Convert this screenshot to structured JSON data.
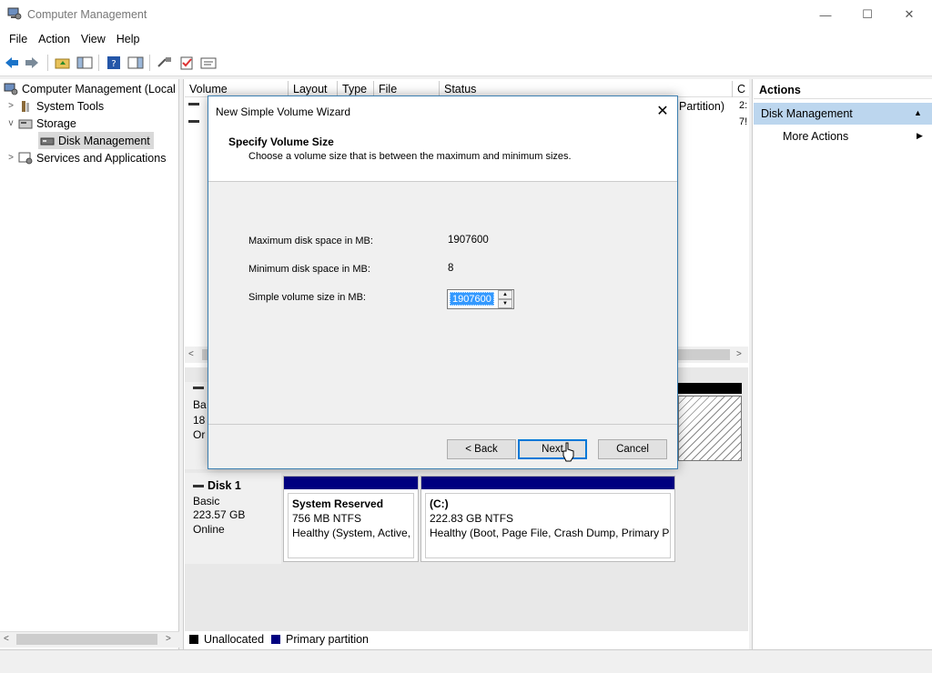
{
  "window": {
    "title": "Computer Management",
    "controls": [
      "—",
      "☐",
      "✕"
    ]
  },
  "menu": [
    "File",
    "Action",
    "View",
    "Help"
  ],
  "tree": {
    "root": "Computer Management (Local",
    "system_tools": "System Tools",
    "storage": "Storage",
    "disk_management": "Disk Management",
    "services": "Services and Applications"
  },
  "volume_columns": [
    "Volume",
    "Layout",
    "Type",
    "File System",
    "Status",
    "C"
  ],
  "partial_text": {
    "partition": "Partition)",
    "cap1": "2:",
    "cap2": "7!",
    "disk0_line1": "Ba",
    "disk0_line2": "18",
    "disk0_line3": "Or"
  },
  "disk1": {
    "name": "Disk 1",
    "type": "Basic",
    "size": "223.57 GB",
    "status": "Online",
    "partitions": [
      {
        "name": "System Reserved",
        "size": "756 MB NTFS",
        "health": "Healthy (System, Active,"
      },
      {
        "name": "(C:)",
        "size": "222.83 GB NTFS",
        "health": "Healthy (Boot, Page File, Crash Dump, Primary P"
      }
    ]
  },
  "legend": {
    "unallocated": "Unallocated",
    "primary": "Primary partition",
    "unallocated_color": "#000000",
    "primary_color": "#000080"
  },
  "actions": {
    "title": "Actions",
    "group": "Disk Management",
    "more": "More Actions"
  },
  "dialog": {
    "title": "New Simple Volume Wizard",
    "heading": "Specify Volume Size",
    "subheading": "Choose a volume size that is between the maximum and minimum sizes.",
    "max_label": "Maximum disk space in MB:",
    "max_value": "1907600",
    "min_label": "Minimum disk space in MB:",
    "min_value": "8",
    "size_label": "Simple volume size in MB:",
    "size_value": "1907600",
    "back": "< Back",
    "next": "Next",
    "cancel": "Cancel"
  }
}
